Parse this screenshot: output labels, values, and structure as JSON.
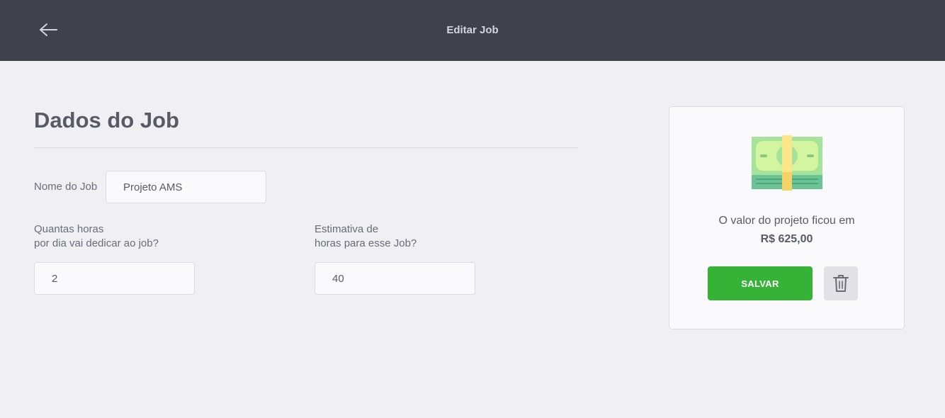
{
  "header": {
    "title": "Editar Job",
    "back_icon": "arrow-left-icon"
  },
  "form": {
    "section_title": "Dados do Job",
    "name_label": "Nome do Job",
    "name_value": "Projeto AMS",
    "hours_label_line1": "Quantas horas",
    "hours_label_line2": "por dia vai dedicar ao job?",
    "hours_value": "2",
    "estimate_label_line1": "Estimativa de",
    "estimate_label_line2": "horas para esse Job?",
    "estimate_value": "40"
  },
  "summary": {
    "icon": "money-icon",
    "text": "O valor do projeto ficou em",
    "value": "R$ 625,00",
    "save_label": "SALVAR",
    "delete_icon": "trash-icon"
  },
  "colors": {
    "topbar": "#41414d",
    "background": "#f0f0f4",
    "save_button": "#36b336",
    "delete_button": "#e1e1e6"
  }
}
